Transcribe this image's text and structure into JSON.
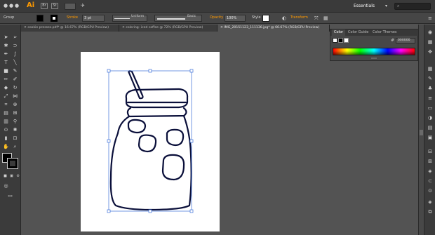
{
  "app": {
    "logo": "Ai",
    "workspace": "Essentials",
    "search_placeholder": ""
  },
  "control_bar": {
    "selection_label": "Group",
    "stroke_label": "Stroke",
    "stroke_weight": "3 pt",
    "profile_label": "Uniform",
    "brush_label": "Basic",
    "opacity_label": "Opacity",
    "opacity_value": "100%",
    "style_label": "Style",
    "transform_label": "Transform",
    "colors": {
      "fill": "#000000",
      "accent": "#ff9a00"
    }
  },
  "tabs": [
    {
      "label": "cookie presses.pdf* @ 16.67% (RGB/GPU Preview)",
      "active": false
    },
    {
      "label": "coloring- iced coffee @ 72% (RGB/GPU Preview)",
      "active": false
    },
    {
      "label": "IMG_20151123_111136.jpg* @ 66.67% (RGB/GPU Preview)",
      "active": true
    }
  ],
  "color_panel": {
    "tabs": [
      {
        "label": "Color",
        "active": true
      },
      {
        "label": "Color Guide",
        "active": false
      },
      {
        "label": "Color Themes",
        "active": false
      }
    ],
    "hex_value": "000000"
  }
}
